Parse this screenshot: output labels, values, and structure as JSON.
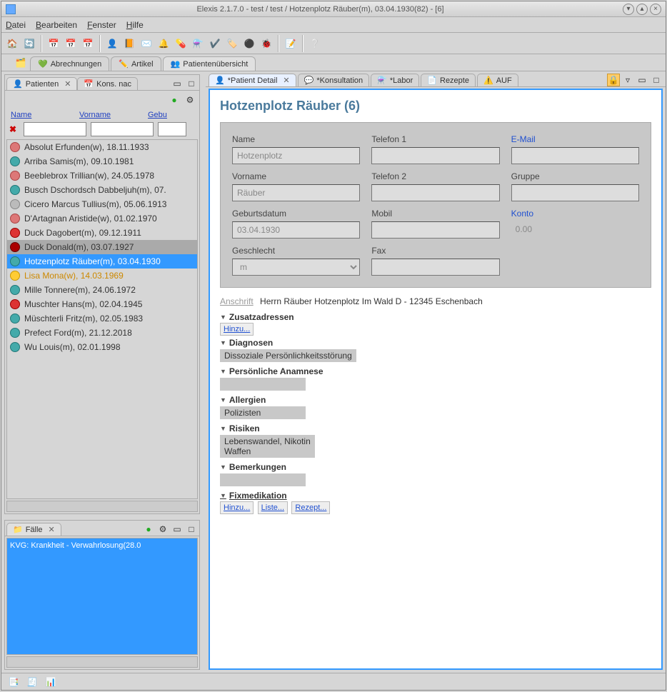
{
  "window": {
    "title": "Elexis 2.1.7.0 -  test / test  / Hotzenplotz Räuber(m), 03.04.1930(82) - [6]"
  },
  "menu": {
    "file": "Datei",
    "edit": "Bearbeiten",
    "window": "Fenster",
    "help": "Hilfe"
  },
  "outerTabs": {
    "abrech": "Abrechnungen",
    "artikel": "Artikel",
    "patUeber": "Patientenübersicht"
  },
  "patientsPanel": {
    "title": "Patienten",
    "otherTab": "Kons. nac",
    "cols": {
      "name": "Name",
      "vorname": "Vorname",
      "geb": "Gebu"
    }
  },
  "patients": [
    {
      "text": "Absolut Erfunden(w), 18.11.1933",
      "icon": "f"
    },
    {
      "text": "Arriba Samis(m), 09.10.1981",
      "icon": "m"
    },
    {
      "text": "Beeblebrox Trillian(w), 24.05.1978",
      "icon": "f"
    },
    {
      "text": "Busch Dschordsch Dabbeljuh(m), 07.",
      "icon": "m"
    },
    {
      "text": "Cicero Marcus Tullius(m), 05.06.1913",
      "icon": "clock"
    },
    {
      "text": "D'Artagnan Aristide(w), 01.02.1970",
      "icon": "f"
    },
    {
      "text": "Duck Dagobert(m), 09.12.1911",
      "icon": "alert"
    },
    {
      "text": "Duck Donald(m), 03.07.1927",
      "icon": "stop",
      "hl": true
    },
    {
      "text": "Hotzenplotz Räuber(m), 03.04.1930",
      "icon": "m",
      "sel": true
    },
    {
      "text": "Lisa Mona(w), 14.03.1969",
      "icon": "sun",
      "warn": true
    },
    {
      "text": "Mille Tonnere(m), 24.06.1972",
      "icon": "m"
    },
    {
      "text": "Muschter Hans(m), 02.04.1945",
      "icon": "alert"
    },
    {
      "text": "Müschterli Fritz(m), 02.05.1983",
      "icon": "m"
    },
    {
      "text": "Prefect Ford(m), 21.12.2018",
      "icon": "m"
    },
    {
      "text": "Wu Louis(m), 02.01.1998",
      "icon": "m"
    }
  ],
  "casesPanel": {
    "title": "Fälle",
    "item": "KVG: Krankheit - Verwahrlosung(28.0"
  },
  "innerTabs": {
    "detail": "*Patient Detail",
    "kons": "*Konsultation",
    "labor": "*Labor",
    "rezepte": "Rezepte",
    "auf": "AUF"
  },
  "detail": {
    "heading": "Hotzenplotz Räuber (6)",
    "labels": {
      "name": "Name",
      "vorname": "Vorname",
      "geb": "Geburtsdatum",
      "geschl": "Geschlecht",
      "tel1": "Telefon 1",
      "tel2": "Telefon 2",
      "mobil": "Mobil",
      "fax": "Fax",
      "email": "E-Mail",
      "gruppe": "Gruppe",
      "konto": "Konto"
    },
    "values": {
      "name": "Hotzenplotz",
      "vorname": "Räuber",
      "geb": "03.04.1930",
      "geschl": "m",
      "tel1": "",
      "tel2": "",
      "mobil": "",
      "fax": "",
      "email": "",
      "gruppe": "",
      "konto": "0.00"
    },
    "addrLabel": "Anschrift",
    "addr": "Herrn Räuber Hotzenplotz Im Wald D - 12345 Eschenbach",
    "sections": {
      "zusatz": "Zusatzadressen",
      "hinzu": "Hinzu...",
      "diag": "Diagnosen",
      "diagTxt": "Dissoziale Persönlichkeitsstörung",
      "anam": "Persönliche Anamnese",
      "allerg": "Allergien",
      "allergTxt": "Polizisten",
      "risk": "Risiken",
      "riskTxt": "Lebenswandel, Nikotin\nWaffen",
      "bem": "Bemerkungen",
      "fixmed": "Fixmedikation",
      "liste": "Liste...",
      "rezept": "Rezept..."
    }
  }
}
